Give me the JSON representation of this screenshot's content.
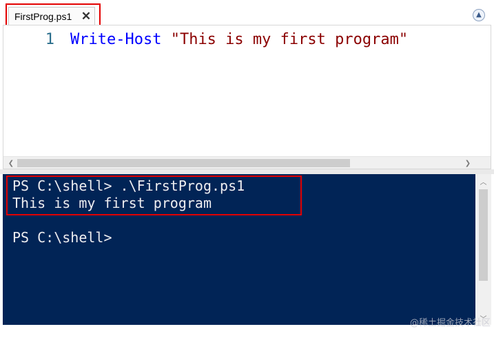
{
  "tabs": [
    {
      "label": "FirstProg.ps1",
      "active": true
    }
  ],
  "editor": {
    "lines": [
      {
        "number": "1",
        "command": "Write-Host",
        "string": "\"This is my first program\""
      }
    ]
  },
  "console": {
    "lines": [
      "PS C:\\shell> .\\FirstProg.ps1",
      "This is my first program",
      "",
      "PS C:\\shell>"
    ]
  },
  "watermark": "@稀土掘金技术社区",
  "colors": {
    "console_background": "#012456",
    "console_text": "#eeedf0",
    "keyword": "#0000ff",
    "string": "#8b0000",
    "highlight": "#e30000"
  },
  "icons": {
    "tab_close": "close-icon",
    "collapse": "chevron-up-icon"
  }
}
